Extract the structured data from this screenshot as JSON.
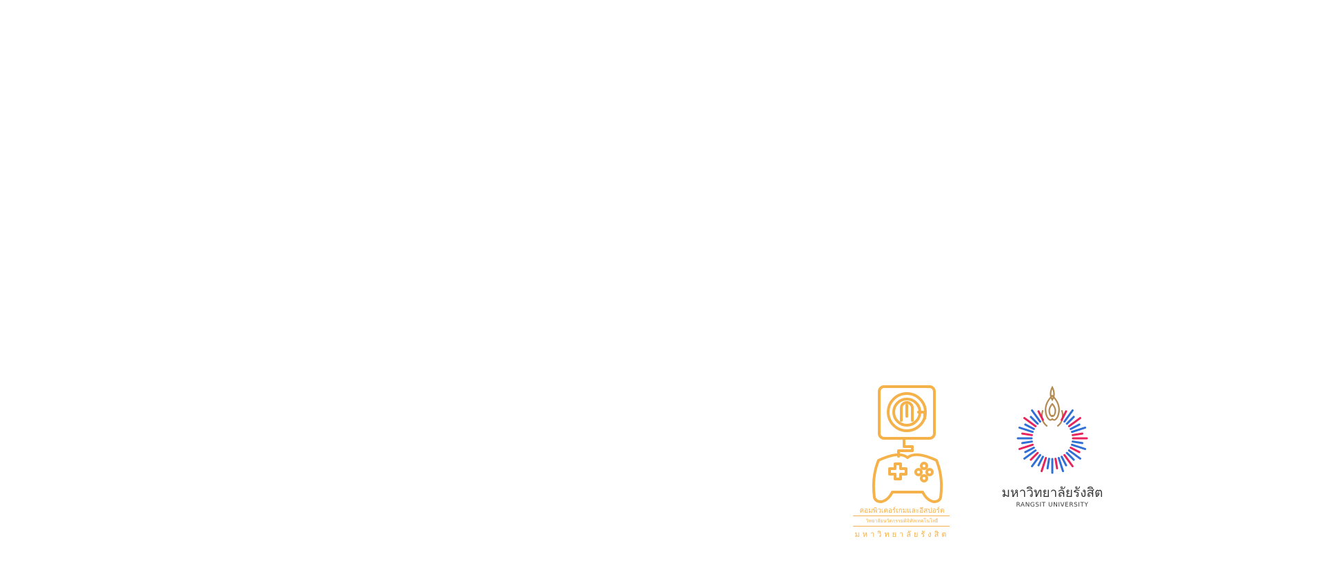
{
  "colors": {
    "background": "#ffffff",
    "game_logo_orange": "#f5b24a",
    "ru_red": "#e8245c",
    "ru_blue": "#2f6fd6",
    "ru_flame_gold": "#b38a52",
    "ru_text": "#3a3a3a"
  },
  "game_logo": {
    "icon": "game-controller-monitor-icon",
    "caption_line1": "คอมพิวเตอร์เกมและอีสปอร์ต",
    "caption_line2": "วิทยาลัยนวัตกรรมดิจิทัลเทคโนโลยี",
    "caption_line3": "มหาวิทยาลัยรังสิต"
  },
  "ru_logo": {
    "icon": "rangsit-university-emblem-icon",
    "name_thai": "มหาวิทยาลัยรังสิต",
    "name_english": "RANGSIT UNIVERSITY"
  }
}
